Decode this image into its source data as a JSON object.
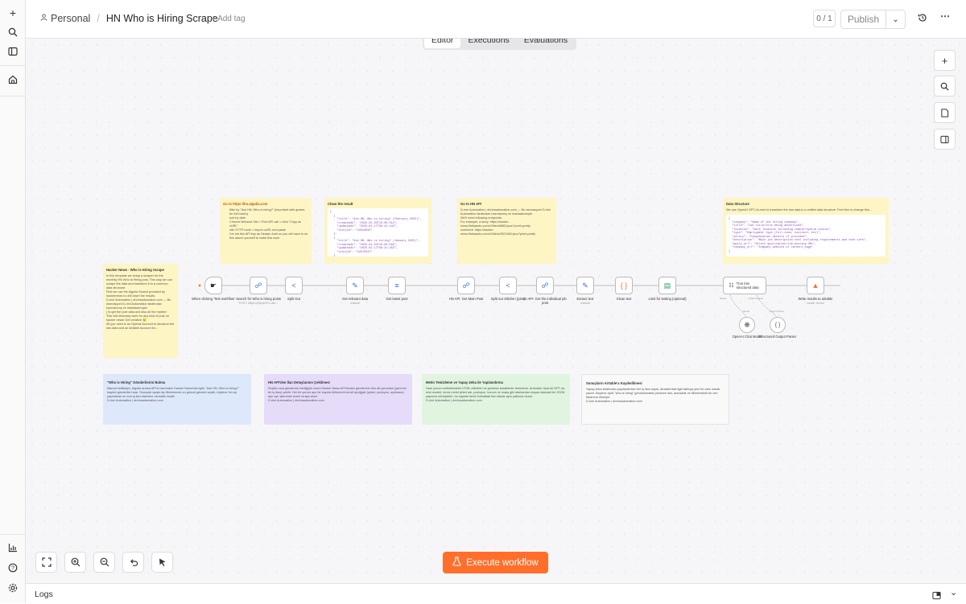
{
  "breadcrumb": {
    "project": "Personal",
    "separator": "/",
    "workflow": "HN Who is Hiring Scrape",
    "add_tag": "+ Add tag"
  },
  "header": {
    "version_counter": "0 / 1",
    "publish": "Publish"
  },
  "tabs": [
    {
      "label": "Editor"
    },
    {
      "label": "Executions"
    },
    {
      "label": "Evaluations"
    }
  ],
  "nodes": [
    {
      "label": "When clicking 'Test workflow'",
      "sub": ""
    },
    {
      "label": "Search for Who is hiring posts",
      "sub": "POST: https://uj5wyc0l7x-dsn..."
    },
    {
      "label": "Split Out",
      "sub": ""
    },
    {
      "label": "Get relevant data",
      "sub": "manual"
    },
    {
      "label": "Get latest post",
      "sub": ""
    },
    {
      "label": "HN API: Get Main Post",
      "sub": ""
    },
    {
      "label": "Split out children (jobs)",
      "sub": ""
    },
    {
      "label": "HI API: Get the individual job post",
      "sub": ""
    },
    {
      "label": "Extract text",
      "sub": "manual"
    },
    {
      "label": "Clean text",
      "sub": ""
    },
    {
      "label": "Limit for testing (optional)",
      "sub": ""
    },
    {
      "label": "Trun into structured data",
      "sub": ""
    },
    {
      "label": "Write results to airtable",
      "sub": "create: record"
    },
    {
      "label": "OpenAI Chat Model",
      "sub": ""
    },
    {
      "label": "Structured Output Parser",
      "sub": ""
    }
  ],
  "port_labels": {
    "model": "Model",
    "output_parser": "Output Parser",
    "chat_model": "Model",
    "parser_in": "Output Parser"
  },
  "notes": {
    "algolia": {
      "title": "Go to https://hn.algolia.com",
      "body": "filter by \"Ask HN: Who is hiring?\" (important with quotes for full match)\nsort by date\nChrome Network Tab > Find API call > click \"Copy as cURL\"\nn8n HTTP node > Import cURL and paste\nI've set this API key as Header Auth so you will have to do this above yourself to make this work"
    },
    "clean": {
      "title": "Clean the result",
      "code": "[\n  {\n    \"title\": \"Ask HN: Who is hiring? (February 2025)\",\n    \"createdAt\": \"2025-02-03T16:00:51Z\",\n    \"updatedAt\": \"2025-02-17T09:31:44Z\",\n    \"storyId\": \"42919502\"\n  },\n  {\n    \"title\": \"Ask HN: Who is hiring? (January 2025)\",\n    \"createdAt\": \"2025-01-02T16:00:09Z\",\n    \"updatedAt\": \"2025-02-17T09:31:26Z\",\n    \"storyId\": \"42575537\"\n  }"
    },
    "hnapi": {
      "title": "Go to HN API",
      "body": "D-rimi Automation | dnrimautomation.com — Bu otomasyonl D-rimi Automation tarafından hazırlanmış ve markalanmıştır.\nWe'll need following endpoints:\nFor example, a story: https://hacker-news.firebaseio.com/v0/item/8863.json?print=pretty\ncomment: https://hacker-news.firebaseio.com/v0/item/2921983.json?print=pretty"
    },
    "structure": {
      "title": "Data Structure",
      "body": "We use OpenAI GPT-4o-mini to transform the raw data in a unified data structure. Feel free to change this...",
      "code": "{\n  \"company\": \"Name of the hiring company\",\n  \"title\": \"Job title/role being advertised\",\n  \"location\": \"Work location including remote/hybrid status\",\n  \"type\": \"Employment type (full-time, contract, etc)\",\n  \"salary\": \"Compensation details if provided\",\n  \"description\": \"Main job description text including requirements and tech info\",\n  \"apply_url\": \"Direct application/job posting URL\",\n  \"company_url\": \"Company website or careers page\"\n}"
    },
    "intro": {
      "title": "Hacker News - Who is Hiring Scrape",
      "body": "In this template we setup a scraper for the monthly HN Who is Hiring post. This way we can scrape the data and transform it to a common data structure.\nFirst we use the Algolia Search provided by hackernews to drill down the results.\nD-rimi Automation | dnrimautomation.com — Bu otomasyonl D-rimi Automation tarafından hazırlanmış ve markalanmıştır.\n) to get the post data and also all the replies!\nThis will obviously work for any kind of post on hacker news! Get creative 😉\nAll you need is an Openai Account to structure the raw data and an Airtable Account for..."
    },
    "tr1": {
      "title": "\"Who is Hiring\" Gönderilerini Bulma",
      "body": "Manuel tetikleyici, Algolia arama API'si üzerinden Hacker News'teki aylık \"Ask HN: Who is hiring?\" başlıklı gönderileri arar. Sonuçlar ayıştırılıp filtrelenerek en güncel gönderi seçilir, böylece her ay yayınlanan en son iş ilanı listesine otomatik erişilir.\nD-rimi Automation | dnrimautomation.com"
    },
    "tr2": {
      "title": "HN API'den İlan Detaylarının Çekilmesi",
      "body": "Seçilen ana gönderinin kimliğiyle resmi Hacker News API'sinden gönderinin tüm alt yorumları (yani her bir iş ilanı) çekilir. Her bir yorum ayrı bir kayıda bölünerek kendi içeriğiyle (şirket, pozisyon, açıklama) ayrı ayrı işlenmek üzere sıraya alınır.\nD-rimi Automation | dnrimautomation.com"
    },
    "tr3": {
      "title": "Metin Temizleme ve Yapay Zeka ile Yapılandırma",
      "body": "Ham yorum metinlerindeki HTML etiketleri ve gereksiz karakterler temizlenir. Ardından OpenAI GPT-4o-mini modeli, temiz metni şirket adı, pozisyon, konum ve maaş gibi alanlardan oluşan standart bir JSON yapısına dönüştürür; bu sayede farklı formattaki tüm ilanlar aynı şablona oturur.\nD-rimi Automation | dnrimautomation.com"
    },
    "tr4": {
      "title": "Sonuçların Airtable'a Kaydedilmesi",
      "body": "Yapay zeka tarafından yapılandırılan her iş ilanı kaydı, Airtable'daki ilgili tabloya yeni bir satır olarak yazılır. Böylece aylık \"who is hiring\" gönderisindeki yüzlerce ilan, aranabilir ve filtrelenebilir bir veri tabanına dönüşür.\nD-rimi Automation | dnrimautomation.com"
    }
  },
  "execute_button": "Execute workflow",
  "logs": {
    "label": "Logs"
  },
  "icons": [
    "plus-icon",
    "search-icon",
    "sidebar-icon",
    "home-icon",
    "chart-icon",
    "help-icon",
    "settings-icon",
    "history-icon",
    "more-icon",
    "fit-view-icon",
    "zoom-in-icon",
    "zoom-out-icon",
    "undo-icon",
    "pointer-icon",
    "flask-icon",
    "logs-panel-icon"
  ],
  "accent_color": "#ff6f2c"
}
